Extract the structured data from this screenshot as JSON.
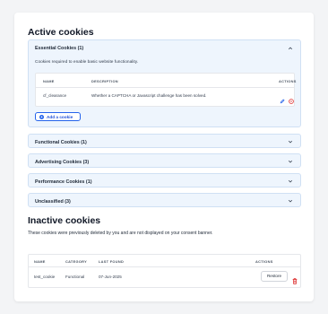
{
  "active": {
    "title": "Active cookies",
    "essential": {
      "title": "Essential Cookies (1)",
      "description": "Cookies required to enable basic website functionality.",
      "columns": {
        "name": "NAME",
        "description": "DESCRIPTION",
        "actions": "ACTIONS"
      },
      "rows": [
        {
          "name": "cf_clearance",
          "description": "Whether a CAPTCHA or Javascript challenge has been solved."
        }
      ],
      "add_label": "Add a cookie"
    },
    "sections": [
      {
        "title": "Functional Cookies (1)"
      },
      {
        "title": "Advertising Cookies (3)"
      },
      {
        "title": "Performance Cookies (1)"
      },
      {
        "title": "Unclassified (3)"
      }
    ]
  },
  "inactive": {
    "title": "Inactive cookies",
    "description": "These cookies were previously deleted by you and are not displayed on your consent banner.",
    "columns": {
      "name": "NAME",
      "category": "CATEGORY",
      "last_found": "LAST FOUND",
      "actions": "ACTIONS"
    },
    "rows": [
      {
        "name": "test_cookie",
        "category": "Functional",
        "last_found": "07-Jun-2025",
        "restore_label": "Restore"
      }
    ]
  },
  "colors": {
    "accent": "#2563eb",
    "accordion_bg": "#eef5fd",
    "accordion_border": "#cfe0f4",
    "danger": "#dc2626"
  },
  "icons": {
    "expanded": "chevron-up-icon",
    "collapsed": "chevron-down-icon",
    "edit": "pencil-icon",
    "remove": "remove-circle-icon",
    "delete": "trash-icon",
    "add": "plus-circle-icon"
  }
}
